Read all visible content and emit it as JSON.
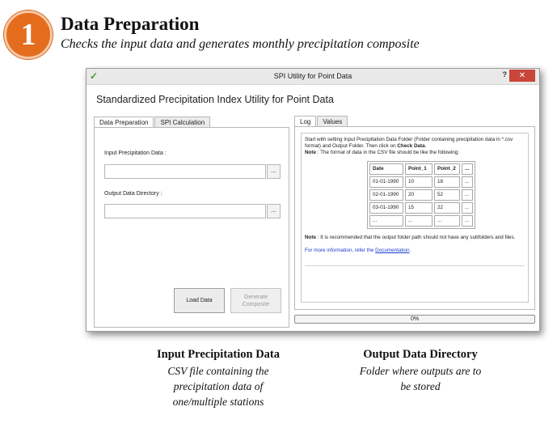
{
  "step": {
    "number": "1",
    "title": "Data Preparation",
    "subtitle": "Checks the input data and generates monthly precipitation composite"
  },
  "window": {
    "title": "SPI Utility for Point Data",
    "help": "?",
    "close": "✕",
    "heading": "Standardized Precipitation Index Utility for Point Data"
  },
  "left_tabs": [
    "Data Preparation",
    "SPI Calculation"
  ],
  "form": {
    "input_label": "Input Precipitation Data :",
    "input_value": "",
    "output_label": "Output Data Directory :",
    "output_value": "",
    "browse_label": "...",
    "load_button": "Load Data",
    "generate_button_line1": "Generate",
    "generate_button_line2": "Composite"
  },
  "right_tabs": [
    "Log",
    "Values"
  ],
  "log": {
    "intro_1": "Start with setting Input Precipitation Data Folder (Folder containing precipitation data in *.csv format)  and Output Folder. Then click on ",
    "intro_bold": "Check Data",
    "intro_2": ".",
    "note_label": "Note",
    "note_1": " : The format of data in the CSV file should be like the following:",
    "table": {
      "headers": [
        "Date",
        "Point_1",
        "Point_2",
        "..."
      ],
      "rows": [
        [
          "01-01-1990",
          "10",
          "18",
          "..."
        ],
        [
          "02-01-1990",
          "20",
          "52",
          "..."
        ],
        [
          "03-01-1990",
          "15",
          "22",
          "..."
        ],
        [
          "...",
          "...",
          "...",
          "..."
        ]
      ]
    },
    "note2_label": "Note",
    "note_2": " : It is recommended that the output folder path should not have any subfolders and files.",
    "more_text": "For more information, refer the ",
    "more_link": "Documentation",
    "more_end": "."
  },
  "progress": {
    "value": 0,
    "label": "0%"
  },
  "captions": {
    "input_title": "Input Precipitation Data",
    "input_line1": "CSV file containing the",
    "input_line2": "precipitation data of",
    "input_line3": "one/multiple stations",
    "output_title": "Output Data Directory",
    "output_line1": "Folder where outputs are to",
    "output_line2": "be stored"
  },
  "colors": {
    "badge": "#e46c1d",
    "close_button": "#c9463a",
    "link": "#1a3ad0"
  }
}
